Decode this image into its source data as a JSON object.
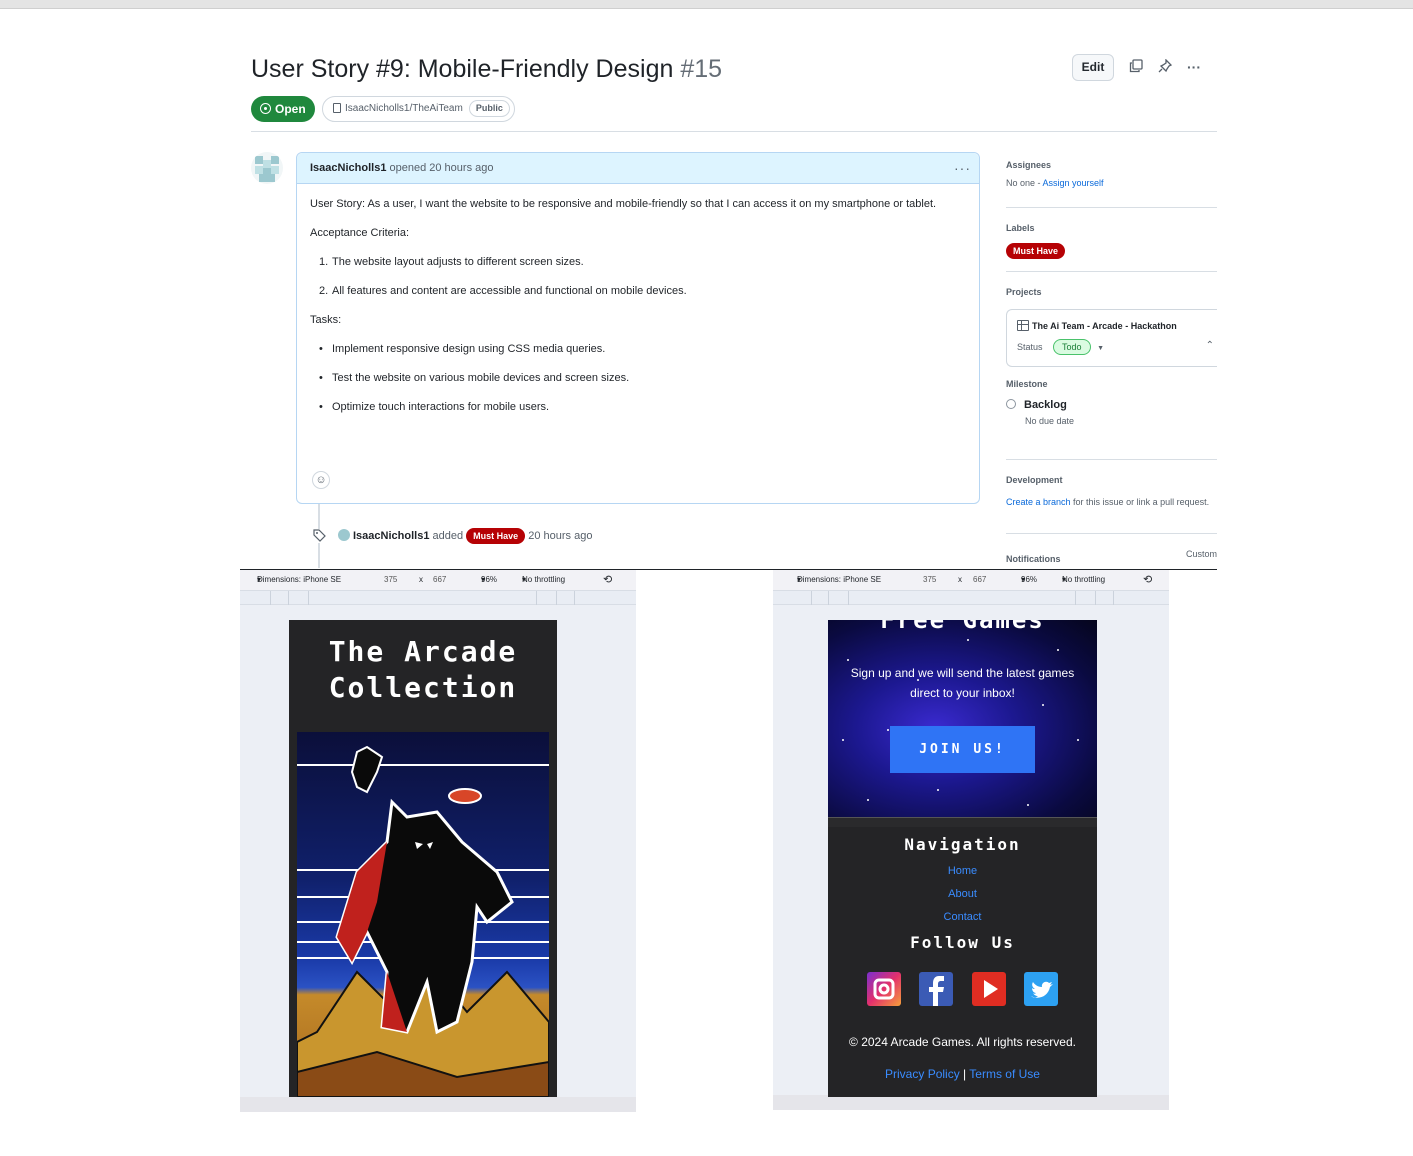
{
  "issue": {
    "title": "User Story #9: Mobile-Friendly Design",
    "number": "#15",
    "state": "Open",
    "repo": "IsaacNicholls1/TheAiTeam",
    "visibility": "Public",
    "edit_label": "Edit"
  },
  "comment": {
    "author": "IsaacNicholls1",
    "meta": "opened 20 hours ago",
    "story": "User Story: As a user, I want the website to be responsive and mobile-friendly so that I can access it on my smartphone or tablet.",
    "acceptance_heading": "Acceptance Criteria:",
    "acceptance": [
      "The website layout adjusts to different screen sizes.",
      "All features and content are accessible and functional on mobile devices."
    ],
    "tasks_heading": "Tasks:",
    "tasks": [
      "Implement responsive design using CSS media queries.",
      "Test the website on various mobile devices and screen sizes.",
      "Optimize touch interactions for mobile users."
    ]
  },
  "event": {
    "author": "IsaacNicholls1",
    "action": "added",
    "label": "Must Have",
    "time": "20 hours ago"
  },
  "sidebar": {
    "assignees_heading": "Assignees",
    "assignees_text": "No one - ",
    "assign_link": "Assign yourself",
    "labels_heading": "Labels",
    "label": "Must Have",
    "projects_heading": "Projects",
    "project_title": "The Ai Team - Arcade - Hackathon",
    "status_label": "Status",
    "status_value": "Todo",
    "milestone_heading": "Milestone",
    "milestone_title": "Backlog",
    "milestone_due": "No due date",
    "development_heading": "Development",
    "dev_link": "Create a branch",
    "dev_text": " for this issue or link a pull request.",
    "notifications_heading": "Notifications",
    "notifications_value": "Custom"
  },
  "devtools": {
    "dimensions": "Dimensions: iPhone SE",
    "width": "375",
    "times": "x",
    "height": "667",
    "zoom": "96%",
    "throttling": "No throttling"
  },
  "left_phone": {
    "title_line1": "The Arcade",
    "title_line2": "Collection"
  },
  "right_phone": {
    "partial_heading": "Free Games",
    "signup_text": "Sign up and we will send the latest games direct to your inbox!",
    "join_button": "JOIN US!",
    "nav_heading": "Navigation",
    "nav_links": [
      "Home",
      "About",
      "Contact"
    ],
    "follow_heading": "Follow Us",
    "copyright": "© 2024 Arcade Games. All rights reserved.",
    "privacy": "Privacy Policy",
    "divider": "|",
    "terms": "Terms of Use"
  },
  "colors": {
    "open_green": "#1f883d",
    "label_red": "#b60205",
    "link_blue": "#0969da",
    "join_blue": "#2f74f5"
  }
}
